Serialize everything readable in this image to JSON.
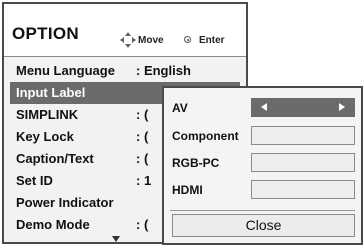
{
  "header": {
    "title": "OPTION",
    "move_label": "Move",
    "enter_label": "Enter"
  },
  "menu": {
    "items": [
      {
        "label": "Menu Language",
        "value": ": English"
      },
      {
        "label": "Input Label",
        "value": ""
      },
      {
        "label": "SIMPLINK",
        "value": ": ("
      },
      {
        "label": "Key Lock",
        "value": ": ("
      },
      {
        "label": "Caption/Text",
        "value": ": ("
      },
      {
        "label": "Set ID",
        "value": ": 1"
      },
      {
        "label": "Power Indicator",
        "value": ""
      },
      {
        "label": "Demo Mode",
        "value": ": ("
      }
    ],
    "selected_index": 1
  },
  "submenu": {
    "rows": [
      {
        "label": "AV",
        "value": ""
      },
      {
        "label": "Component",
        "value": ""
      },
      {
        "label": "RGB-PC",
        "value": ""
      },
      {
        "label": "HDMI",
        "value": ""
      }
    ],
    "close_label": "Close"
  },
  "icons": {
    "move": "four-way-arrow-icon",
    "enter": "enter-circle-icon",
    "selected": "enter-circle-icon",
    "scroll": "scroll-down-arrow-icon",
    "av_left": "arrow-left-icon",
    "av_right": "arrow-right-icon"
  },
  "colors": {
    "selected_bg": "#6b6b6b",
    "panel_bg": "#f2f2f2",
    "border": "#4a4a4a"
  }
}
